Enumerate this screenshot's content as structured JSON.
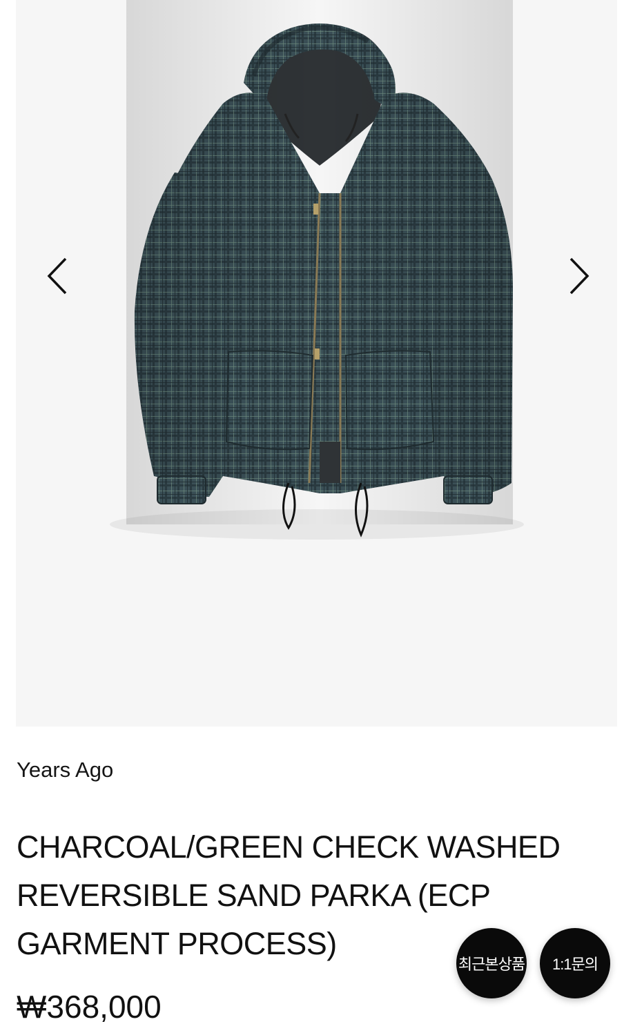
{
  "gallery": {
    "prev_icon": "chevron-left-icon",
    "next_icon": "chevron-right-icon",
    "image": "reversible sand parka photo"
  },
  "product": {
    "brand": "Years Ago",
    "title": "CHARCOAL/GREEN CHECK WASHED REVERSIBLE SAND PARKA (ECP GARMENT PROCESS)",
    "price": "₩368,000"
  },
  "floating": {
    "recent_label": "최근본상품",
    "inquiry_label": "1:1문의"
  },
  "colors": {
    "gallery_bg": "#f6f6f6",
    "fab_bg": "#0a0a0a",
    "jacket_main": "#3b4f55",
    "text": "#111111"
  }
}
